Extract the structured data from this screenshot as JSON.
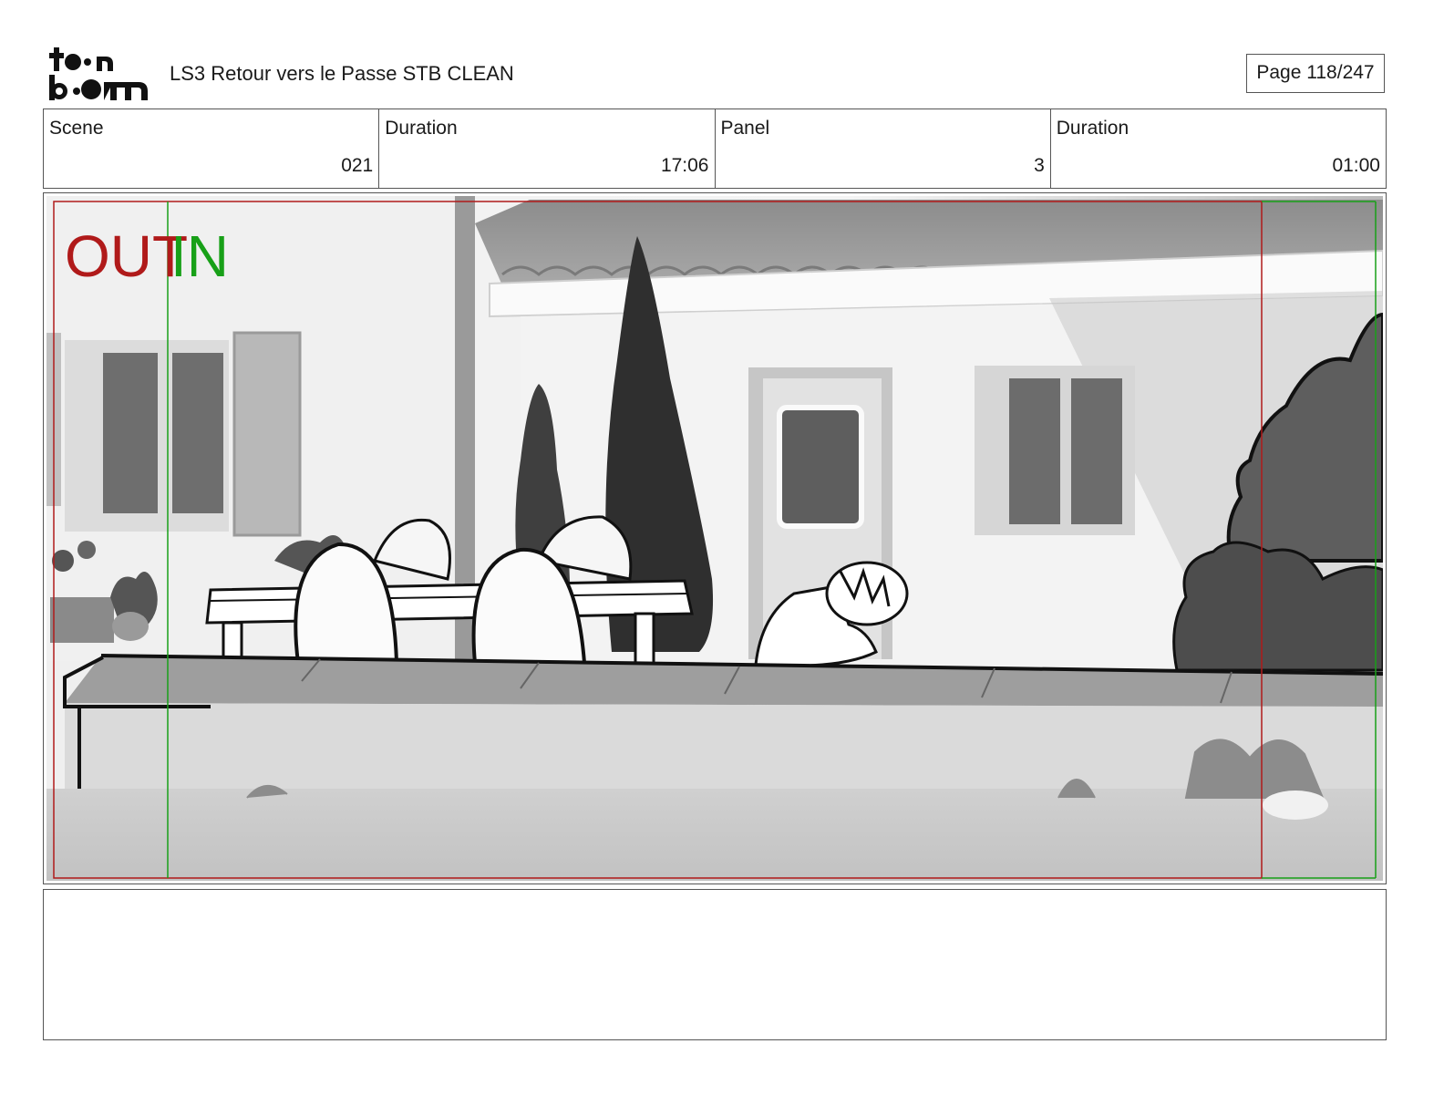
{
  "header": {
    "logo_text": "toonboom",
    "document_title": "LS3 Retour vers le Passe STB CLEAN",
    "page_indicator": "Page 118/247"
  },
  "info": {
    "scene_label": "Scene",
    "scene_value": "021",
    "scene_duration_label": "Duration",
    "scene_duration_value": "17:06",
    "panel_label": "Panel",
    "panel_value": "3",
    "panel_duration_label": "Duration",
    "panel_duration_value": "01:00"
  },
  "panel": {
    "out_label": "OUT",
    "in_label": "IN",
    "colors": {
      "out": "#b01a1a",
      "in": "#18a018"
    }
  },
  "notes": {
    "text": ""
  }
}
